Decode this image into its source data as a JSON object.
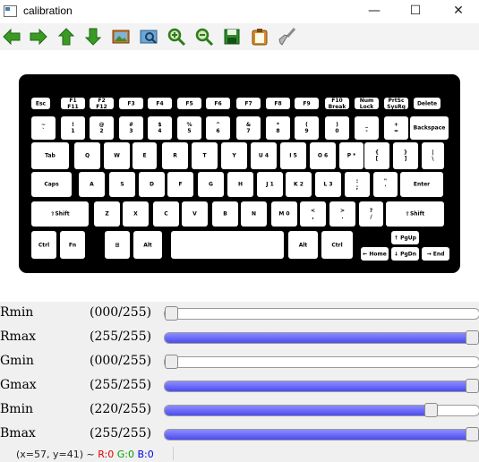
{
  "window": {
    "title": "calibration",
    "minimize": "—",
    "maximize": "☐",
    "close": "✕"
  },
  "toolbar": [
    {
      "name": "back-icon"
    },
    {
      "name": "forward-icon"
    },
    {
      "name": "up-icon"
    },
    {
      "name": "down-icon"
    },
    {
      "name": "image-icon"
    },
    {
      "name": "zoom-fit-icon"
    },
    {
      "name": "zoom-in-icon"
    },
    {
      "name": "zoom-out-icon"
    },
    {
      "name": "save-icon"
    },
    {
      "name": "clipboard-icon"
    },
    {
      "name": "clear-brush-icon"
    }
  ],
  "keyboard": {
    "rows": [
      [
        {
          "t": "Esc"
        },
        {
          "t": "F1\nF11"
        },
        {
          "t": "F2\nF12"
        },
        {
          "t": "F3"
        },
        {
          "t": "F4"
        },
        {
          "t": "F5"
        },
        {
          "t": "F6"
        },
        {
          "t": "F7"
        },
        {
          "t": "F8"
        },
        {
          "t": "F9"
        },
        {
          "t": "F10\nBreak"
        },
        {
          "t": "Num\nLock"
        },
        {
          "t": "PrtSc\nSysRq"
        },
        {
          "t": "Delete"
        }
      ],
      [
        {
          "t": "~\n`"
        },
        {
          "t": "!\n1"
        },
        {
          "t": "@\n2"
        },
        {
          "t": "#\n3"
        },
        {
          "t": "$\n4"
        },
        {
          "t": "%\n5"
        },
        {
          "t": "^\n6"
        },
        {
          "t": "&\n7"
        },
        {
          "t": "*\n8"
        },
        {
          "t": "(\n9"
        },
        {
          "t": ")\n0"
        },
        {
          "t": "_\n-"
        },
        {
          "t": "+\n="
        },
        {
          "t": "Backspace"
        }
      ],
      [
        {
          "t": "Tab"
        },
        {
          "t": "Q"
        },
        {
          "t": "W"
        },
        {
          "t": "E"
        },
        {
          "t": "R"
        },
        {
          "t": "T"
        },
        {
          "t": "Y"
        },
        {
          "t": "U 4"
        },
        {
          "t": "I 5"
        },
        {
          "t": "O 6"
        },
        {
          "t": "P *"
        },
        {
          "t": "{\n["
        },
        {
          "t": "}\n]"
        },
        {
          "t": "|\n\\"
        }
      ],
      [
        {
          "t": "Caps"
        },
        {
          "t": "A"
        },
        {
          "t": "S"
        },
        {
          "t": "D"
        },
        {
          "t": "F"
        },
        {
          "t": "G"
        },
        {
          "t": "H"
        },
        {
          "t": "J 1"
        },
        {
          "t": "K 2"
        },
        {
          "t": "L 3"
        },
        {
          "t": ":\n;"
        },
        {
          "t": "\"\n'"
        },
        {
          "t": "Enter"
        }
      ],
      [
        {
          "t": "⇧Shift"
        },
        {
          "t": "Z"
        },
        {
          "t": "X"
        },
        {
          "t": "C"
        },
        {
          "t": "V"
        },
        {
          "t": "B"
        },
        {
          "t": "N"
        },
        {
          "t": "M 0"
        },
        {
          "t": "<\n,"
        },
        {
          "t": ">\n."
        },
        {
          "t": "?\n/"
        },
        {
          "t": "⇧Shift"
        }
      ],
      [
        {
          "t": "Ctrl"
        },
        {
          "t": "Fn"
        },
        {
          "t": "⊞"
        },
        {
          "t": "Alt"
        },
        {
          "t": ""
        },
        {
          "t": "Alt"
        },
        {
          "t": "Ctrl"
        },
        {
          "t": "↑ PgUp"
        },
        {
          "t": "← Home"
        },
        {
          "t": "↓ PgDn"
        },
        {
          "t": "→ End"
        }
      ]
    ]
  },
  "sliders": [
    {
      "label": "Rmin",
      "value": "(000/255)",
      "level": 0
    },
    {
      "label": "Rmax",
      "value": "(255/255)",
      "level": 255
    },
    {
      "label": "Gmin",
      "value": "(000/255)",
      "level": 0
    },
    {
      "label": "Gmax",
      "value": "(255/255)",
      "level": 255
    },
    {
      "label": "Bmin",
      "value": "(220/255)",
      "level": 220
    },
    {
      "label": "Bmax",
      "value": "(255/255)",
      "level": 255
    }
  ],
  "status": {
    "coords": "(x=57, y=41) ~ ",
    "r": "R:0",
    "g": "G:0",
    "b": "B:0",
    "colors": {
      "r": "#e00000",
      "g": "#00a000",
      "b": "#0000e0"
    }
  }
}
